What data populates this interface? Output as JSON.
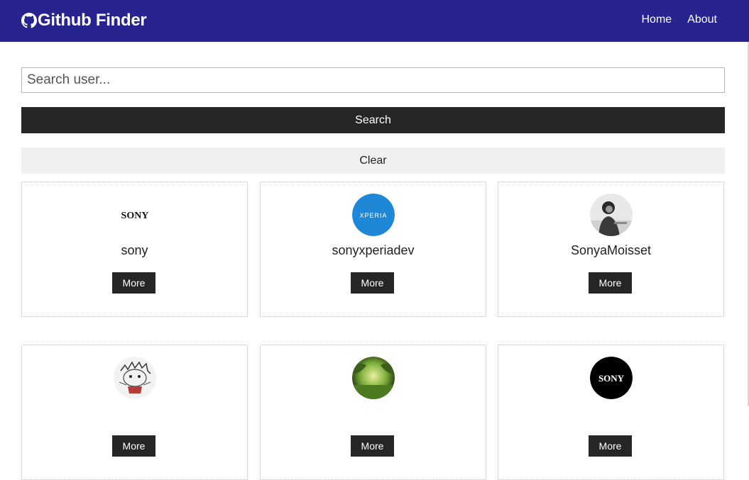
{
  "navbar": {
    "brand_icon": "github-icon",
    "brand_title": "Github Finder",
    "links": [
      {
        "label": "Home"
      },
      {
        "label": "About"
      }
    ]
  },
  "search": {
    "placeholder": "Search user...",
    "value": "",
    "search_label": "Search",
    "clear_label": "Clear"
  },
  "users": [
    {
      "login": "sony",
      "avatar": "sony-logo-avatar",
      "more_label": "More"
    },
    {
      "login": "sonyxperiadev",
      "avatar": "xperia-logo-avatar",
      "avatar_text": "XPERIA",
      "more_label": "More"
    },
    {
      "login": "SonyaMoisset",
      "avatar": "person-photo-avatar",
      "more_label": "More"
    },
    {
      "login": "",
      "avatar": "sketch-drawing-avatar",
      "more_label": "More"
    },
    {
      "login": "",
      "avatar": "landscape-photo-avatar",
      "more_label": "More"
    },
    {
      "login": "",
      "avatar": "sony-black-circle-avatar",
      "more_label": "More"
    }
  ],
  "logo_text": {
    "sony_plain": "SONY",
    "sony_black": "SONY"
  },
  "colors": {
    "navbar": "#27238f",
    "dark_button": "#262626",
    "light_button": "#f0f0f0",
    "xperia_blue": "#1e88d6"
  }
}
